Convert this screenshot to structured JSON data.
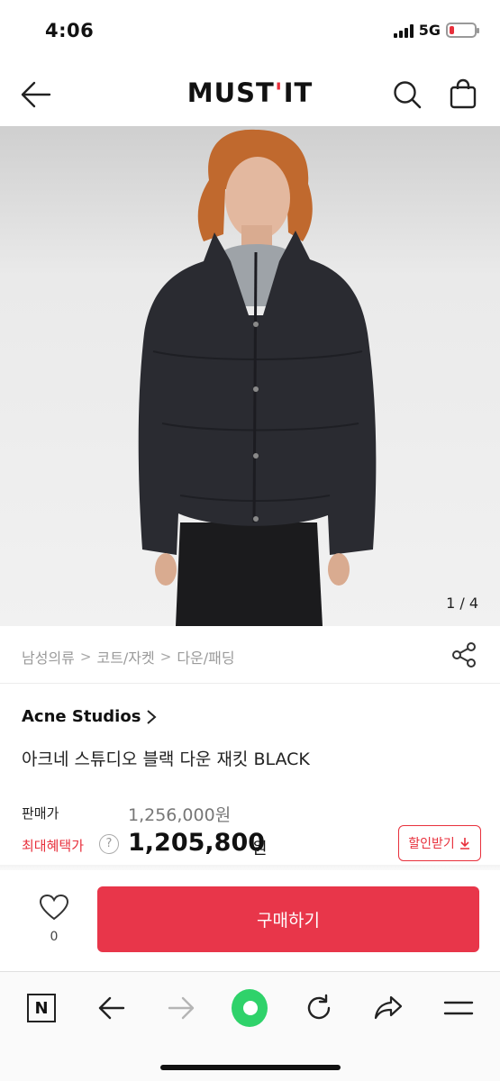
{
  "status": {
    "time": "4:06",
    "network": "5G"
  },
  "header": {
    "logo_left": "MUST",
    "logo_apostrophe": "'",
    "logo_right": "IT"
  },
  "gallery": {
    "counter": "1 / 4"
  },
  "breadcrumb": [
    "남성의류",
    "코트/자켓",
    "다운/패딩"
  ],
  "product": {
    "brand": "Acne Studios",
    "name": "아크네 스튜디오 블랙 다운 재킷 BLACK"
  },
  "pricing": {
    "sale_label": "판매가",
    "original_price": "1,256,000원",
    "benefit_label": "최대혜택가",
    "help_symbol": "?",
    "final_price": "1,205,800",
    "currency": "원",
    "coupon_label": "할인받기"
  },
  "buy_bar": {
    "like_count": "0",
    "buy_label": "구매하기"
  },
  "browser": {
    "n_label": "N"
  },
  "colors": {
    "accent": "#e8364a",
    "brand_red": "#e8303c",
    "home_green": "#2fd26a"
  },
  "icons": [
    "back-arrow-icon",
    "search-icon",
    "shopping-bag-icon",
    "share-icon",
    "chevron-right-icon",
    "help-icon",
    "download-icon",
    "heart-icon",
    "browser-back-icon",
    "browser-forward-icon",
    "reload-icon",
    "share-arrow-icon",
    "menu-icon"
  ]
}
